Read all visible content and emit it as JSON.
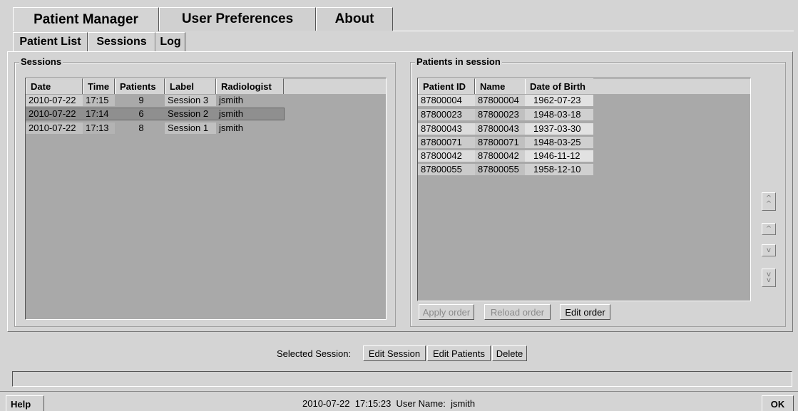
{
  "tabs": {
    "patient_manager": "Patient Manager",
    "user_preferences": "User Preferences",
    "about": "About"
  },
  "subtabs": {
    "patient_list": "Patient List",
    "sessions": "Sessions",
    "log": "Log"
  },
  "sessions_panel": {
    "title": "Sessions",
    "columns": [
      "Date",
      "Time",
      "Patients",
      "Label",
      "Radiologist"
    ],
    "rows": [
      {
        "date": "2010-07-22",
        "time": "17:15",
        "patients": "9",
        "label": "Session 3",
        "radiologist": "jsmith"
      },
      {
        "date": "2010-07-22",
        "time": "17:14",
        "patients": "6",
        "label": "Session 2",
        "radiologist": "jsmith"
      },
      {
        "date": "2010-07-22",
        "time": "17:13",
        "patients": "8",
        "label": "Session 1",
        "radiologist": "jsmith"
      }
    ]
  },
  "patients_panel": {
    "title": "Patients in session",
    "columns": [
      "Patient ID",
      "Name",
      "Date of Birth"
    ],
    "rows": [
      {
        "id": "87800004",
        "name": "87800004",
        "dob": "1962-07-23"
      },
      {
        "id": "87800023",
        "name": "87800023",
        "dob": "1948-03-18"
      },
      {
        "id": "87800043",
        "name": "87800043",
        "dob": "1937-03-30"
      },
      {
        "id": "87800071",
        "name": "87800071",
        "dob": "1948-03-25"
      },
      {
        "id": "87800042",
        "name": "87800042",
        "dob": "1946-11-12"
      },
      {
        "id": "87800055",
        "name": "87800055",
        "dob": "1958-12-10"
      }
    ],
    "apply_order": "Apply order",
    "reload_order": "Reload order",
    "edit_order": "Edit order"
  },
  "selected_session": {
    "label": "Selected Session:",
    "edit_session": "Edit Session",
    "edit_patients": "Edit Patients",
    "delete": "Delete"
  },
  "footer": {
    "help": "Help",
    "status": "2010-07-22  17:15:23  User Name:  jsmith",
    "ok": "OK"
  },
  "icons": [
    "move-top-icon",
    "move-up-icon",
    "move-down-icon",
    "move-bottom-icon"
  ]
}
